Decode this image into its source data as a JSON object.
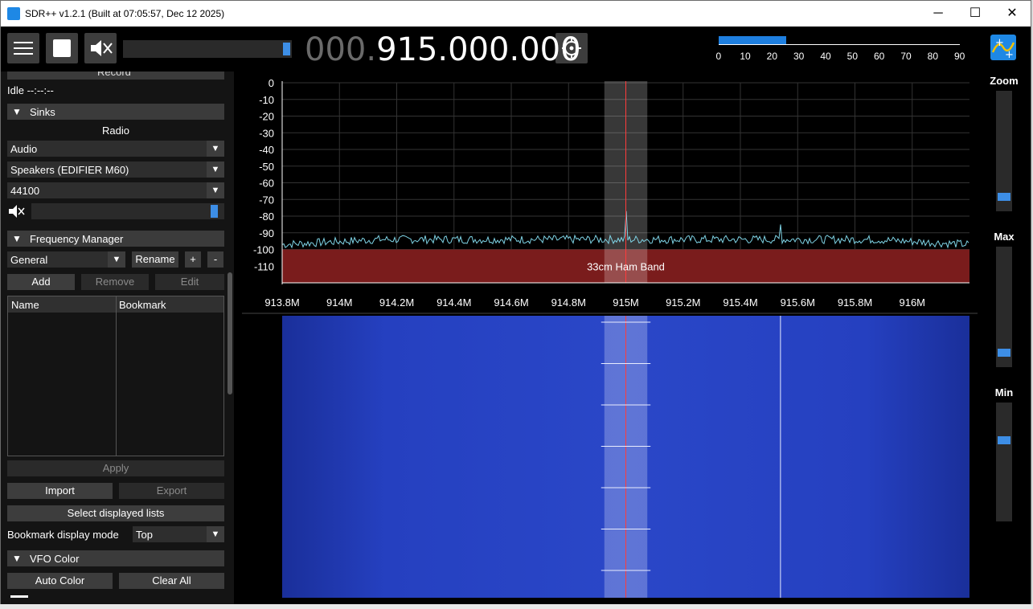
{
  "window": {
    "title": "SDR++ v1.2.1 (Built at 07:05:57, Dec 12 2025)",
    "minimize_icon": "─",
    "maximize_icon": "☐",
    "close_icon": "✕"
  },
  "toolbar": {
    "freq_dim": "000.",
    "freq_bright": "915.000.000",
    "menu_icon": "☰",
    "play_icon": "■",
    "mute_icon": "🔇",
    "snr_scale": [
      "0",
      "10",
      "20",
      "30",
      "40",
      "50",
      "60",
      "70",
      "80",
      "90"
    ],
    "snr_fill": 0.25
  },
  "left": {
    "record_header": "Record",
    "status": "Idle --:--:--",
    "sinks_header": "Sinks",
    "radio_label": "Radio",
    "sink_type": "Audio",
    "device": "Speakers (EDIFIER M60)",
    "samplerate": "44100",
    "volume_fill": 0.98,
    "freq_manager_header": "Frequency Manager",
    "list_select": "General",
    "rename_label": "Rename",
    "plus_label": "+",
    "minus_label": "-",
    "add_label": "Add",
    "remove_label": "Remove",
    "edit_label": "Edit",
    "col_name": "Name",
    "col_bookmark": "Bookmark",
    "apply_label": "Apply",
    "import_label": "Import",
    "export_label": "Export",
    "select_lists_label": "Select displayed lists",
    "bookmark_mode_label": "Bookmark display mode",
    "bookmark_mode_value": "Top",
    "vfo_color_header": "VFO Color",
    "auto_color_label": "Auto Color",
    "clear_all_label": "Clear All"
  },
  "right": {
    "zoom_label": "Zoom",
    "max_label": "Max",
    "min_label": "Min",
    "zoom_level": 0.08,
    "max_level": 0.08,
    "min_level": 0.7
  },
  "colors": {
    "trace": "#7fd4e6",
    "band_fill": "#7a1c1c",
    "vfo_line": "#ff3b3b",
    "accent": "#3d8ee6"
  },
  "chart_data": {
    "type": "line",
    "title": "",
    "xlabel": "",
    "ylabel": "",
    "x_ticks": [
      "913.8M",
      "914M",
      "914.2M",
      "914.4M",
      "914.6M",
      "914.8M",
      "915M",
      "915.2M",
      "915.4M",
      "915.6M",
      "915.8M",
      "916M"
    ],
    "x_tick_values": [
      913.8,
      914.0,
      914.2,
      914.4,
      914.6,
      914.8,
      915.0,
      915.2,
      915.4,
      915.6,
      915.8,
      916.0
    ],
    "xlim": [
      913.8,
      916.2
    ],
    "y_ticks": [
      "0",
      "-10",
      "-20",
      "-30",
      "-40",
      "-50",
      "-60",
      "-70",
      "-80",
      "-90",
      "-100",
      "-110"
    ],
    "ylim": [
      -120,
      0
    ],
    "noise_floor": -94,
    "peaks": [
      {
        "x": 915.0,
        "y": -77
      },
      {
        "x": 915.54,
        "y": -85
      }
    ],
    "band": {
      "label": "33cm Ham Band",
      "y_top": -100
    },
    "vfo": {
      "center": 915.0,
      "width": 0.15
    }
  }
}
